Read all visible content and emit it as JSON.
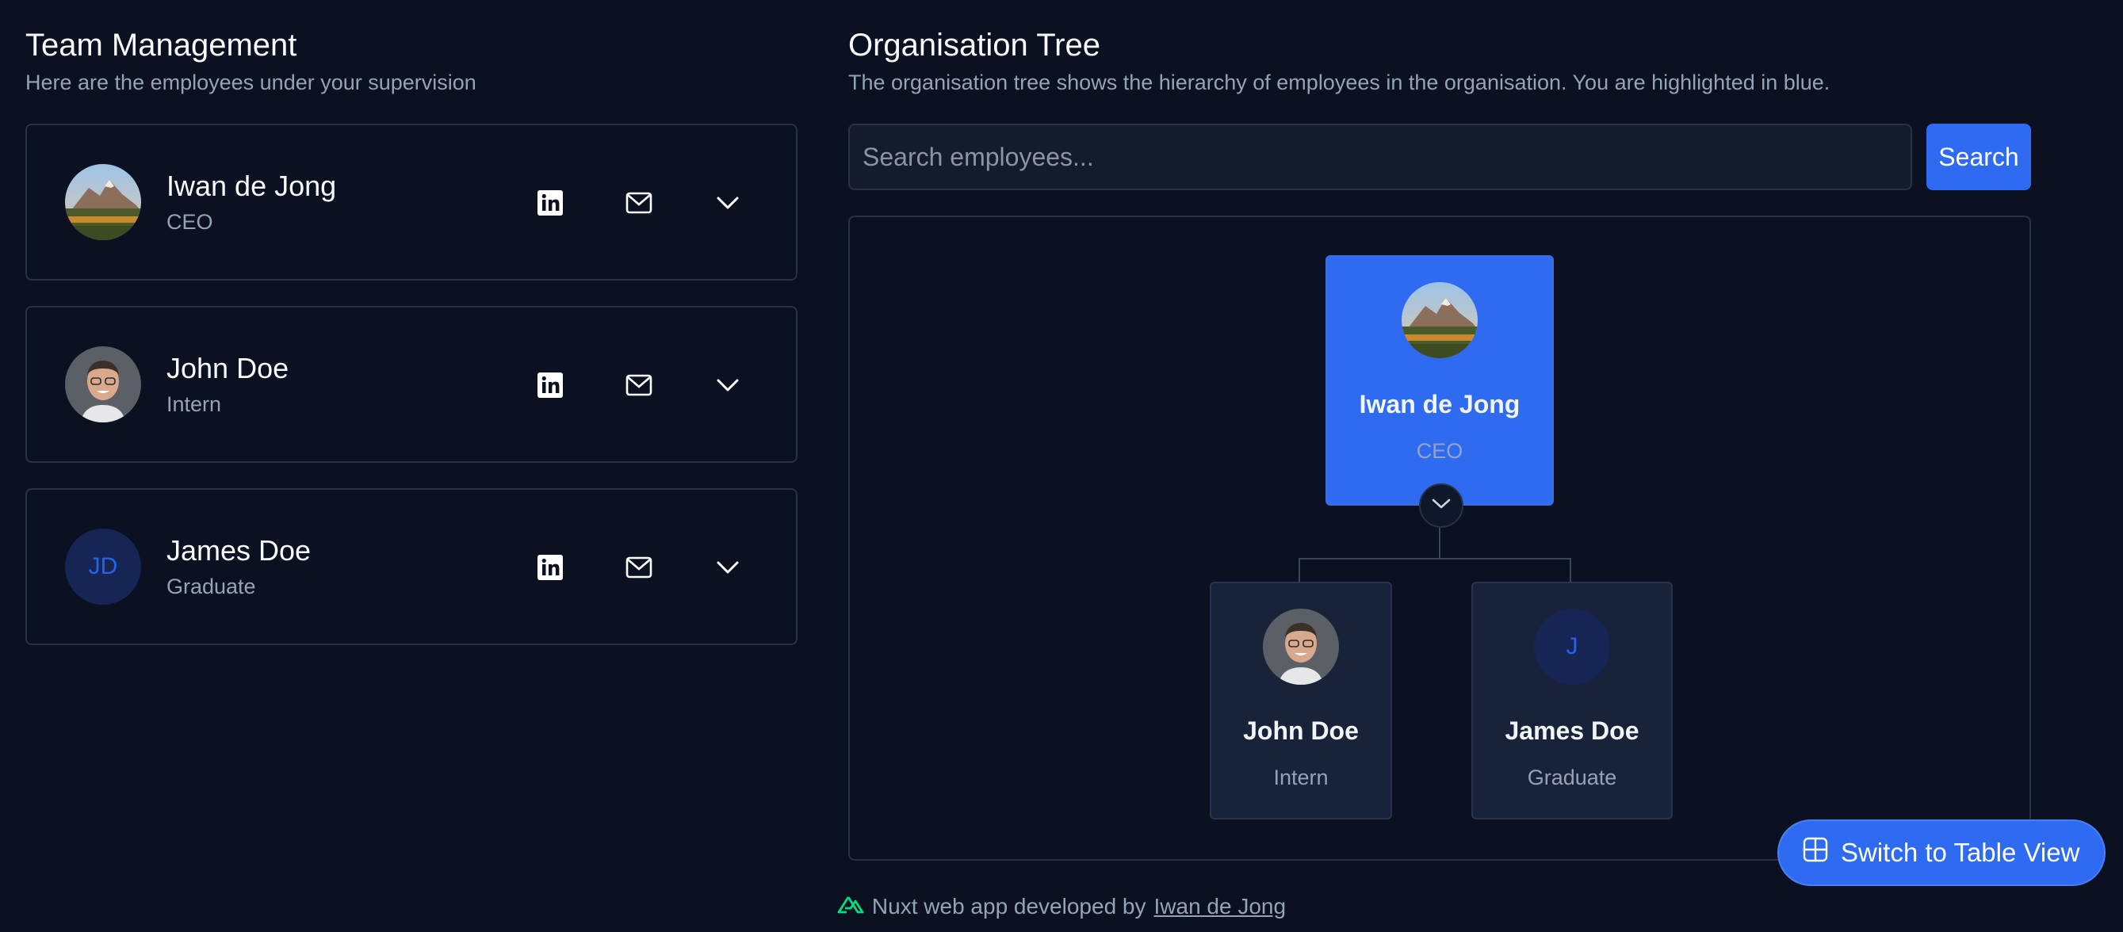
{
  "team": {
    "title": "Team Management",
    "subtitle": "Here are the employees under your supervision",
    "members": [
      {
        "name": "Iwan de Jong",
        "role": "CEO",
        "avatar": "landscape-photo"
      },
      {
        "name": "John Doe",
        "role": "Intern",
        "avatar": "person-photo"
      },
      {
        "name": "James Doe",
        "role": "Graduate",
        "initials": "JD"
      }
    ]
  },
  "tree": {
    "title": "Organisation Tree",
    "subtitle": "The organisation tree shows the hierarchy of employees in the organisation. You are highlighted in blue.",
    "search_placeholder": "Search employees...",
    "search_button": "Search",
    "root": {
      "name": "Iwan de Jong",
      "role": "CEO"
    },
    "children": [
      {
        "name": "John Doe",
        "role": "Intern"
      },
      {
        "name": "James Doe",
        "role": "Graduate",
        "initial": "J"
      }
    ]
  },
  "fab": {
    "label": "Switch to Table View",
    "icon": "table-grid-icon"
  },
  "footer": {
    "text": "Nuxt web app developed by",
    "link": "Iwan de Jong",
    "icon": "nuxt-logo-icon"
  },
  "colors": {
    "background": "#0b1120",
    "accent": "#2f6bf0",
    "border": "#273244",
    "muted": "#94a3b8",
    "nuxt_green": "#00dc82"
  }
}
